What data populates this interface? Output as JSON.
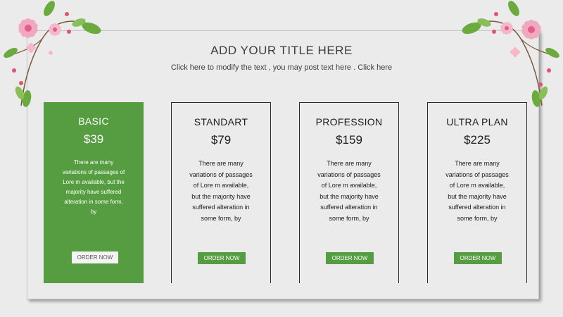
{
  "slide": {
    "title": "ADD YOUR TITLE HERE",
    "subtitle": "Click here to modify the text , you may post text here . Click here"
  },
  "plans": [
    {
      "name": "BASIC",
      "price": "$39",
      "description": "There are many variations of passages of Lore m available, but the majority have suffered alteration in some form, by",
      "button": "ORDER NOW"
    },
    {
      "name": "STANDART",
      "price": "$79",
      "description": "There are many variations of passages of Lore m available, but the majority have suffered alteration in some form, by",
      "button": "ORDER NOW"
    },
    {
      "name": "PROFESSION",
      "price": "$159",
      "description": "There are many variations of passages of Lore m available, but the majority have suffered alteration in some form, by",
      "button": "ORDER NOW"
    },
    {
      "name": "ULTRA PLAN",
      "price": "$225",
      "description": "There are many variations of passages of Lore m available, but the majority have suffered alteration in some form, by",
      "button": "ORDER NOW"
    }
  ],
  "colors": {
    "accent": "#559d40",
    "background": "#ebebeb",
    "flower": "#f2a9c0",
    "leaf": "#6bab3e"
  }
}
